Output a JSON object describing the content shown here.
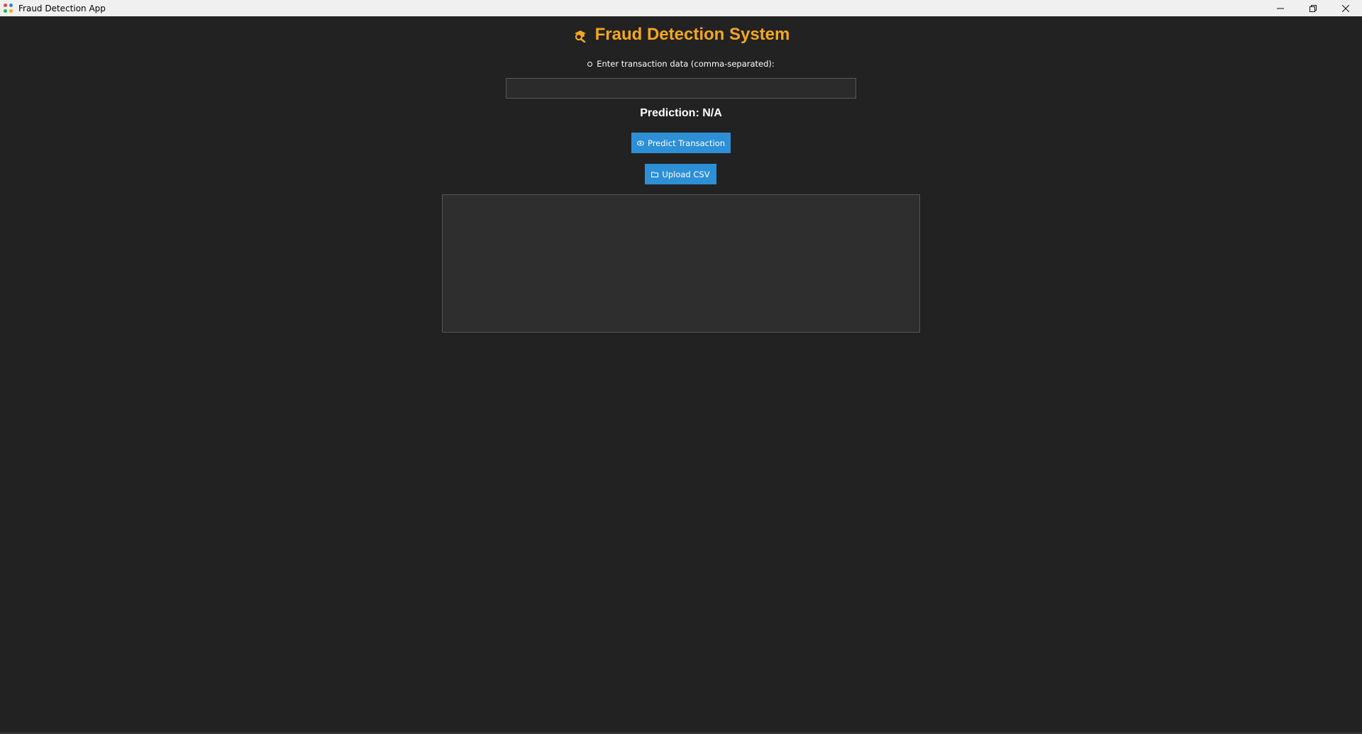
{
  "window": {
    "title": "Fraud Detection App",
    "app_icon": "app-icon",
    "controls": {
      "minimize": "minimize-icon",
      "restore": "restore-icon",
      "close": "close-icon"
    }
  },
  "header": {
    "title": "Fraud Detection System",
    "icon": "detective-icon",
    "color": "#f5a623"
  },
  "form": {
    "instruction_icon": "bullet-icon",
    "instruction": "Enter transaction data (comma-separated):",
    "input_value": "",
    "input_placeholder": ""
  },
  "result": {
    "prediction_text": "Prediction: N/A"
  },
  "actions": {
    "predict_label": "Predict Transaction",
    "predict_icon": "eye-icon",
    "upload_label": "Upload CSV",
    "upload_icon": "folder-icon",
    "button_color": "#2d8fd5"
  },
  "output": {
    "text": ""
  },
  "theme": {
    "background": "#222222",
    "panel": "#2e2e2e"
  }
}
